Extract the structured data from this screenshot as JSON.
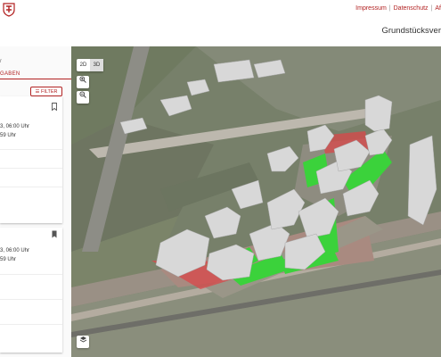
{
  "header": {
    "links": [
      "Impressum",
      "Datenschutz",
      "Af"
    ],
    "page_title": "Grundstücksver"
  },
  "sidebar": {
    "tab_top": "r",
    "tab_active": "GABEN",
    "filter_label": "FILTER",
    "cards": [
      {
        "line1": "3, 06:00 Uhr",
        "line2": "59 Uhr"
      },
      {
        "line1": "3, 06:00 Uhr",
        "line2": "59 Uhr"
      }
    ]
  },
  "map": {
    "toggle_2d": "2D",
    "toggle_3d": "3D",
    "active_mode": "3D",
    "zoom_in_icon": "zoom-in-icon",
    "zoom_out_icon": "zoom-out-icon",
    "layers_icon": "layers-icon"
  },
  "colors": {
    "accent": "#b22222",
    "plot_green": "#3bd23b",
    "plot_red": "#d9474a"
  }
}
